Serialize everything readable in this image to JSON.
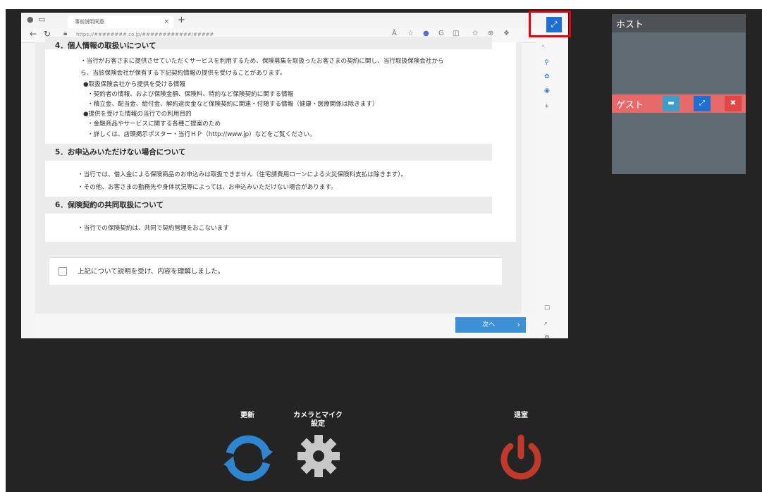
{
  "browser": {
    "tab_title": "事前説明同意",
    "tab_close": "×",
    "new_tab": "+",
    "url": "https://########.co.jp/############/#####",
    "read_aloud": "Ã"
  },
  "document": {
    "section4_cut": "4．個人情報の取扱いについて",
    "intro1": "・当行がお客さまに提供させていただくサービスを利用するため、保険募集を取扱ったお客さまの契約に関し、当行取扱保険会社から",
    "intro2": "ら、当該保険会社が保有する下記契約情報の提供を受けることがあります。",
    "b1": "●取扱保険会社から提供を受ける情報",
    "b1a": "・契約者の情報、および保険金額、保険料、特約など保険契約に関する情報",
    "b1b": "・積立金、配当金、給付金、解約返戻金など保険契約に関連・付随する情報（健康・医療関係は除きます）",
    "b2": "●提供を受けた情報の当行での利用目的",
    "b2a": "・金融商品やサービスに関する各種ご提案のため",
    "b2b": "・詳しくは、店頭掲示ポスター・当行ＨＰ（http://www.jp）などをご覧ください。",
    "section5": "5．お申込みいただけない場合について",
    "s5a": "・当行では、借入金による保険商品のお申込みは取扱できません（住宅請費用ローンによる火災保険料支払は除きます）。",
    "s5b": "・その他、お客さまの勤務先や身体状況等によっては、お申込みいただけない場合があります。",
    "section6": "6．保険契約の共同取扱について",
    "s6a": "・当行での保険契約は、共同で契約管理をおこないます",
    "confirm": "上記について説明を受け、内容を理解しました。",
    "next": "次へ",
    "next_arrow": "›"
  },
  "panels": {
    "host_title": "ホスト",
    "guest_title": "ゲスト"
  },
  "controls": {
    "refresh": "更新",
    "camera_mic_line1": "カメラとマイク",
    "camera_mic_line2": "設定",
    "leave": "退室"
  },
  "colors": {
    "expand_button": "#1e6fd1",
    "highlight_border": "#e8000a",
    "refresh": "#2f86d0",
    "gear": "#c8c8c8",
    "power": "#c0392b",
    "guest_bar": "#e8696a",
    "guest_min": "#3ba0c8",
    "guest_close": "#e04848"
  }
}
